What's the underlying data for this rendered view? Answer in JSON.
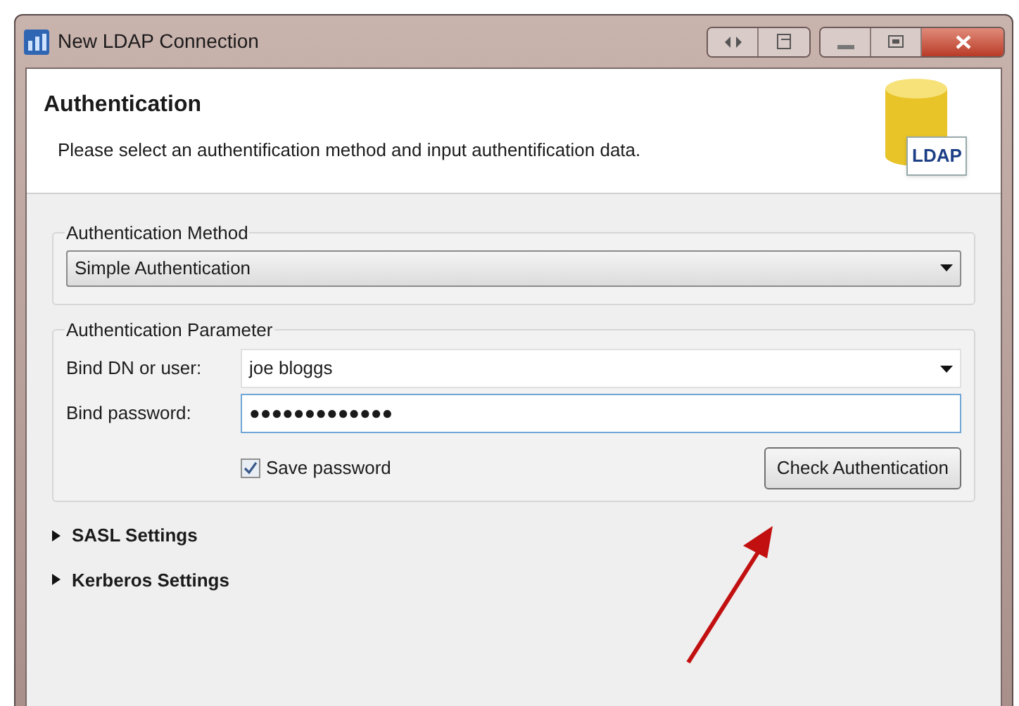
{
  "window": {
    "title": "New LDAP Connection"
  },
  "header": {
    "title": "Authentication",
    "description": "Please select an authentification method and input authentification data.",
    "logo_text": "LDAP"
  },
  "method_group": {
    "legend": "Authentication Method",
    "value": "Simple Authentication"
  },
  "parameter_group": {
    "legend": "Authentication Parameter",
    "fields": [
      {
        "label": "Bind DN or user:",
        "value": "joe bloggs",
        "kind": "combo",
        "focused": false
      },
      {
        "label": "Bind password:",
        "value": "●●●●●●●●●●●●●",
        "kind": "text",
        "focused": true
      }
    ],
    "save_password": {
      "label": "Save password",
      "checked": true
    },
    "check_button": "Check Authentication"
  },
  "sections": [
    {
      "label": "SASL Settings",
      "expanded": false
    },
    {
      "label": "Kerberos Settings",
      "expanded": false
    }
  ]
}
